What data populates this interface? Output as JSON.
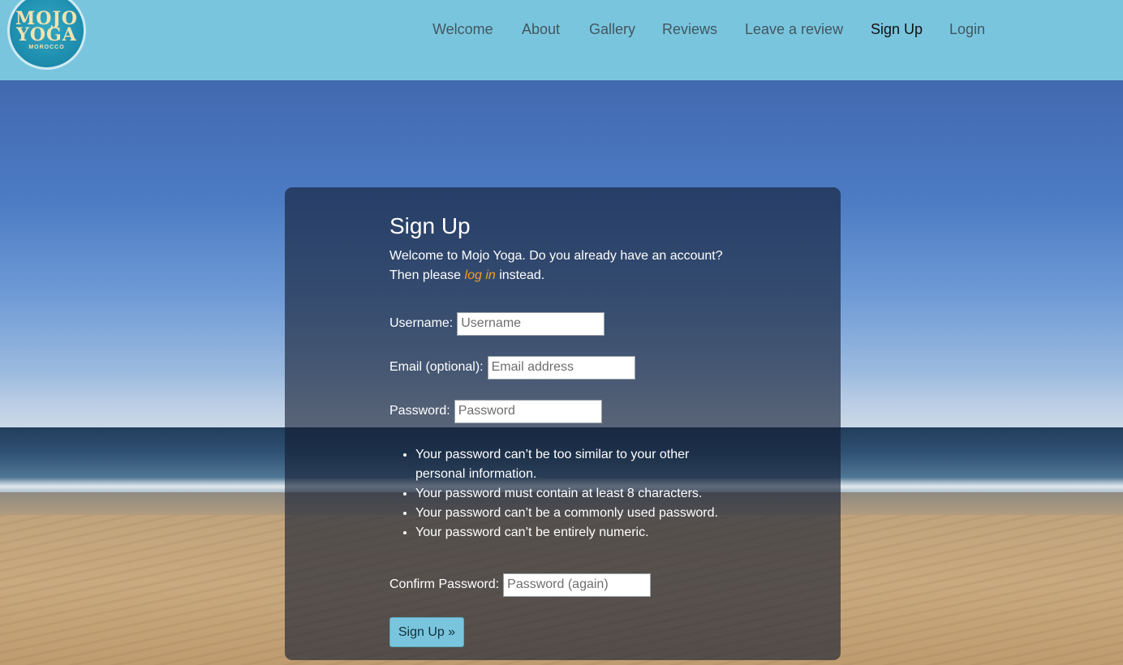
{
  "brand": {
    "logo_line1": "MOJO",
    "logo_line2": "YOGA",
    "logo_line3": "MOROCCO"
  },
  "nav": {
    "items": [
      {
        "label": "Welcome"
      },
      {
        "label": "About"
      },
      {
        "label": "Gallery"
      },
      {
        "label": "Reviews"
      },
      {
        "label": "Leave a review"
      },
      {
        "label": "Sign Up",
        "active": true
      },
      {
        "label": "Login"
      }
    ]
  },
  "form": {
    "title": "Sign Up",
    "intro_before": "Welcome to Mojo Yoga. Do you already have an account? Then please ",
    "intro_link": "log in",
    "intro_after": " instead.",
    "username_label": "Username:",
    "username_placeholder": "Username",
    "email_label": "Email (optional):",
    "email_placeholder": "Email address",
    "password_label": "Password:",
    "password_placeholder": "Password",
    "password_rules": [
      "Your password can’t be too similar to your other personal information.",
      "Your password must contain at least 8 characters.",
      "Your password can’t be a commonly used password.",
      "Your password can’t be entirely numeric."
    ],
    "confirm_label": "Confirm Password:",
    "confirm_placeholder": "Password (again)",
    "submit_label": "Sign Up »"
  },
  "colors": {
    "header": "#7ac5de",
    "link_accent": "#f0a020",
    "card_overlay": "rgba(18,28,48,0.62)",
    "button": "#7ac5de"
  }
}
